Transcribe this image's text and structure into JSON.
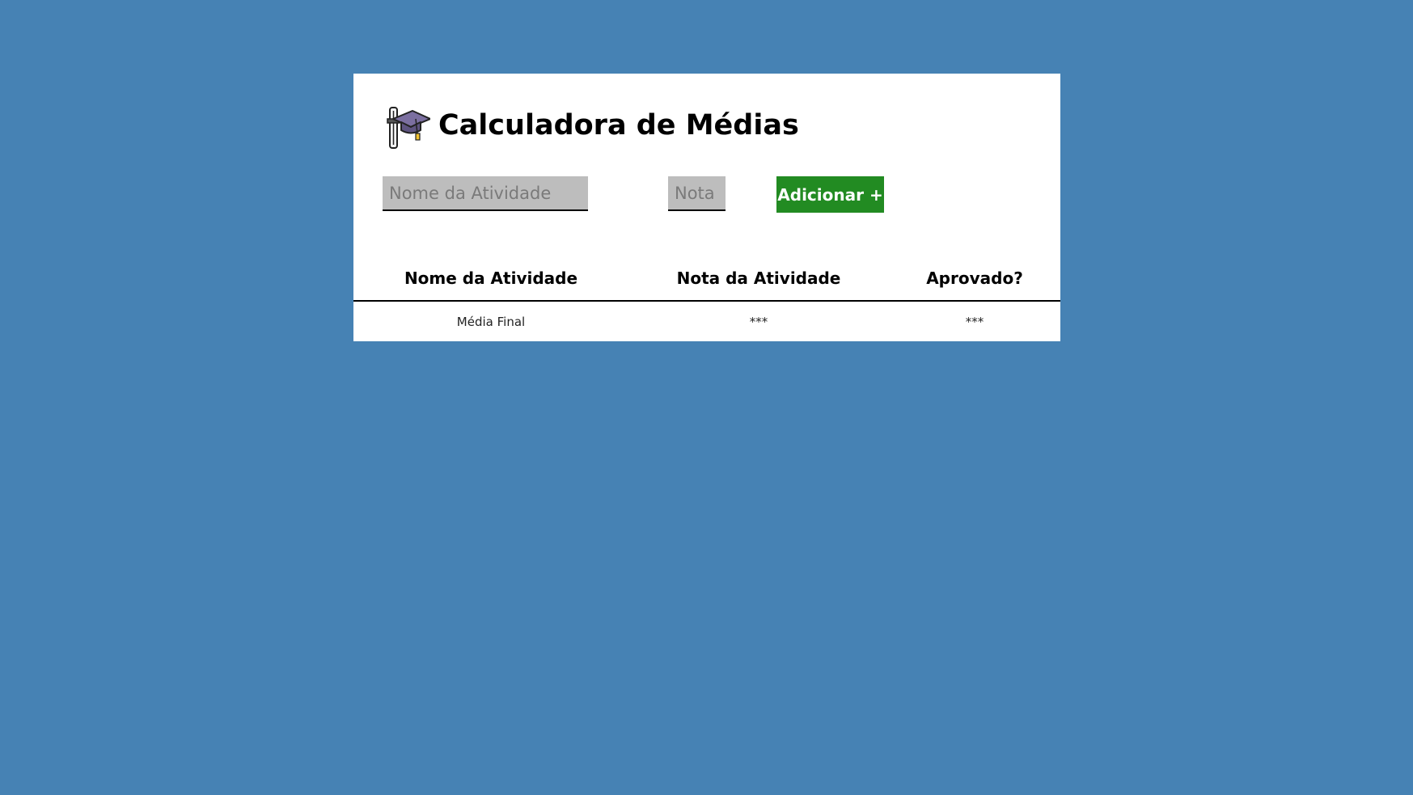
{
  "app": {
    "title": "Calculadora de Médias",
    "logo_icon": "graduation-cap-diploma-icon"
  },
  "form": {
    "name_placeholder": "Nome da Atividade",
    "name_value": "",
    "grade_placeholder": "Nota",
    "grade_value": "",
    "add_label": "Adicionar +"
  },
  "table": {
    "headers": [
      "Nome da Atividade",
      "Nota da Atividade",
      "Aprovado?"
    ],
    "rows": [
      [
        "Média Final",
        "***",
        "***"
      ]
    ]
  },
  "colors": {
    "page_background": "#4682b4",
    "card_background": "#ffffff",
    "input_background": "#bdbdbd",
    "add_button": "#228b22"
  }
}
